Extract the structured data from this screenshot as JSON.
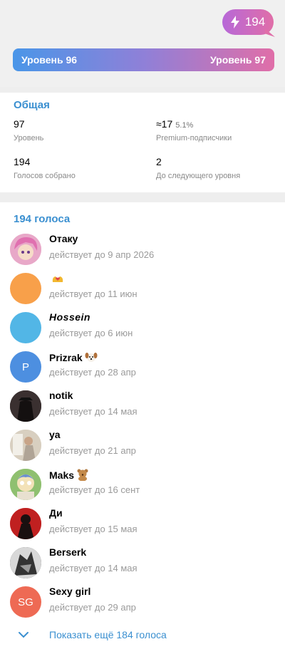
{
  "header": {
    "boost_count": "194",
    "current_level_label": "Уровень 96",
    "next_level_label": "Уровень 97"
  },
  "overview": {
    "title": "Общая",
    "level": {
      "value": "97",
      "label": "Уровень"
    },
    "premium": {
      "value": "≈17",
      "percent": "5.1%",
      "label": "Premium-подписчики"
    },
    "votes": {
      "value": "194",
      "label": "Голосов собрано"
    },
    "to_next": {
      "value": "2",
      "label": "До следующего уровня"
    }
  },
  "boosters": {
    "title": "194 голоса",
    "items": [
      {
        "name": "Отаку",
        "sub": "действует до 9 апр 2026",
        "avatar": "anime-pink-hair",
        "color": "#e8a8c8"
      },
      {
        "name": "",
        "sub": "действует до 11 июн",
        "avatar": "solid",
        "color": "#f8a04a",
        "emoji": "hands-heart"
      },
      {
        "name": "Hossein",
        "sub": "действует до 6 июн",
        "avatar": "solid",
        "color": "#52b6e6",
        "italic": true
      },
      {
        "name": "Prizrak",
        "sub": "действует до 28 апр",
        "avatar": "letter",
        "letter": "P",
        "color": "#4d8fe0",
        "emoji": "dog"
      },
      {
        "name": "notik",
        "sub": "действует до 14 мая",
        "avatar": "dark-figure",
        "color": "#2a2222"
      },
      {
        "name": "ya",
        "sub": "действует до 21 апр",
        "avatar": "photo",
        "color": "#d8cfc0"
      },
      {
        "name": "Maks",
        "sub": "действует до 16 сент",
        "avatar": "cartoon",
        "color": "#8fc070",
        "emoji": "bear"
      },
      {
        "name": "Ди",
        "sub": "действует до 15 мая",
        "avatar": "red-figure",
        "color": "#c02020"
      },
      {
        "name": "Berserk",
        "sub": "действует до 14 мая",
        "avatar": "sketch",
        "color": "#777777"
      },
      {
        "name": "Sexy girl",
        "sub": "действует до 29 апр",
        "avatar": "letter",
        "letter": "SG",
        "color": "#ee6a54"
      }
    ]
  },
  "show_more": {
    "label": "Показать ещё 184 голоса"
  },
  "colors": {
    "accent": "#3a8fd0",
    "gradient_start": "#4a96e8",
    "gradient_end": "#e06ea8"
  }
}
